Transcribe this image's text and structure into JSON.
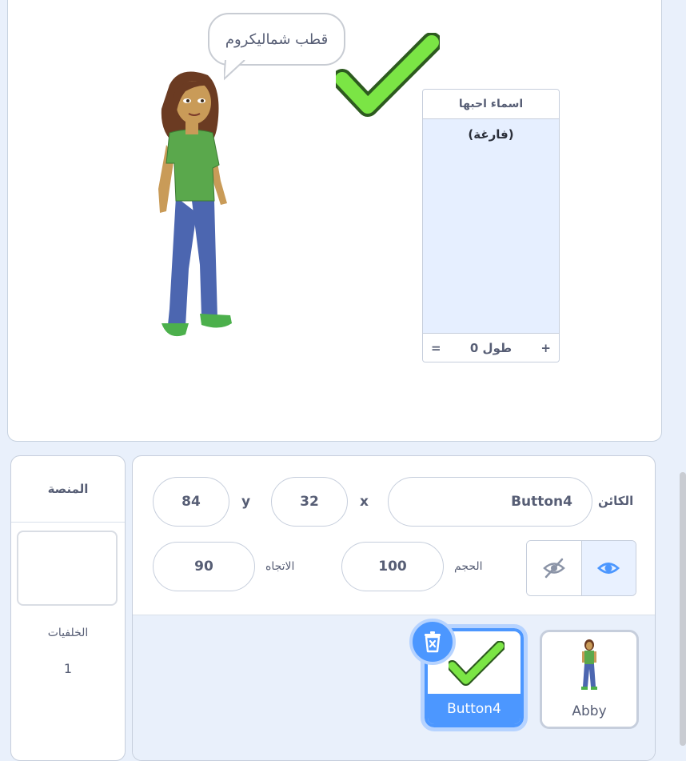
{
  "stage": {
    "speech_bubble": "قطب شماليكروم",
    "list_monitor": {
      "title": "اسماء احبها",
      "empty_label": "(فارغة)",
      "add_label": "+",
      "length_label": "طول 0",
      "resize_label": "="
    }
  },
  "stage_selector": {
    "title": "المنصة",
    "backdrops_label": "الخلفيات",
    "backdrops_count": "1"
  },
  "sprite_info": {
    "sprite_label": "الكائن",
    "sprite_name": "Button4",
    "x_label": "x",
    "x_value": "32",
    "y_label": "y",
    "y_value": "84",
    "show_label": "",
    "size_label": "الحجم",
    "size_value": "100",
    "direction_label": "الاتجاه",
    "direction_value": "90"
  },
  "sprites": [
    {
      "name": "Button4",
      "selected": true
    },
    {
      "name": "Abby",
      "selected": false
    }
  ],
  "colors": {
    "accent": "#4c97ff",
    "check_green": "#7be545",
    "panel_border": "#c6cedc",
    "background": "#e9f0fb"
  }
}
